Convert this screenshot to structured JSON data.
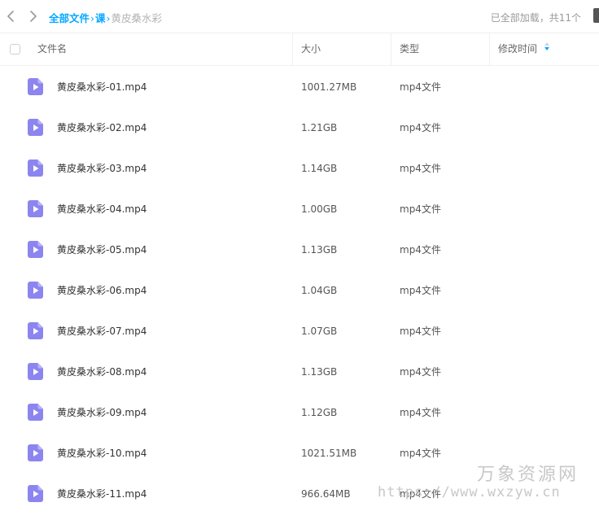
{
  "breadcrumb": {
    "items": [
      "全部文件",
      "课"
    ],
    "separator": "›",
    "current": "黄皮桑水彩"
  },
  "status_text": "已全部加载，共11个",
  "columns": {
    "name": "文件名",
    "size": "大小",
    "type": "类型",
    "modified": "修改时间"
  },
  "files": [
    {
      "name": "黄皮桑水彩-01.mp4",
      "size": "1001.27MB",
      "type": "mp4文件",
      "icon": "video-file-icon"
    },
    {
      "name": "黄皮桑水彩-02.mp4",
      "size": "1.21GB",
      "type": "mp4文件",
      "icon": "video-file-icon"
    },
    {
      "name": "黄皮桑水彩-03.mp4",
      "size": "1.14GB",
      "type": "mp4文件",
      "icon": "video-file-icon"
    },
    {
      "name": "黄皮桑水彩-04.mp4",
      "size": "1.00GB",
      "type": "mp4文件",
      "icon": "video-file-icon"
    },
    {
      "name": "黄皮桑水彩-05.mp4",
      "size": "1.13GB",
      "type": "mp4文件",
      "icon": "video-file-icon"
    },
    {
      "name": "黄皮桑水彩-06.mp4",
      "size": "1.04GB",
      "type": "mp4文件",
      "icon": "video-file-icon"
    },
    {
      "name": "黄皮桑水彩-07.mp4",
      "size": "1.07GB",
      "type": "mp4文件",
      "icon": "video-file-icon"
    },
    {
      "name": "黄皮桑水彩-08.mp4",
      "size": "1.13GB",
      "type": "mp4文件",
      "icon": "video-file-icon"
    },
    {
      "name": "黄皮桑水彩-09.mp4",
      "size": "1.12GB",
      "type": "mp4文件",
      "icon": "video-file-icon"
    },
    {
      "name": "黄皮桑水彩-10.mp4",
      "size": "1021.51MB",
      "type": "mp4文件",
      "icon": "video-file-icon"
    },
    {
      "name": "黄皮桑水彩-11.mp4",
      "size": "966.64MB",
      "type": "mp4文件",
      "icon": "video-file-icon"
    }
  ],
  "watermark": {
    "title": "万象资源网",
    "url": "https://www.wxzyw.cn"
  },
  "colors": {
    "accent": "#06a7ff",
    "file_icon": "#8c85f0",
    "muted_text": "#999999"
  },
  "icons": {
    "back": "chevron-left-icon",
    "forward": "chevron-right-icon",
    "sort": "sort-icon",
    "checkbox": "checkbox-icon"
  }
}
